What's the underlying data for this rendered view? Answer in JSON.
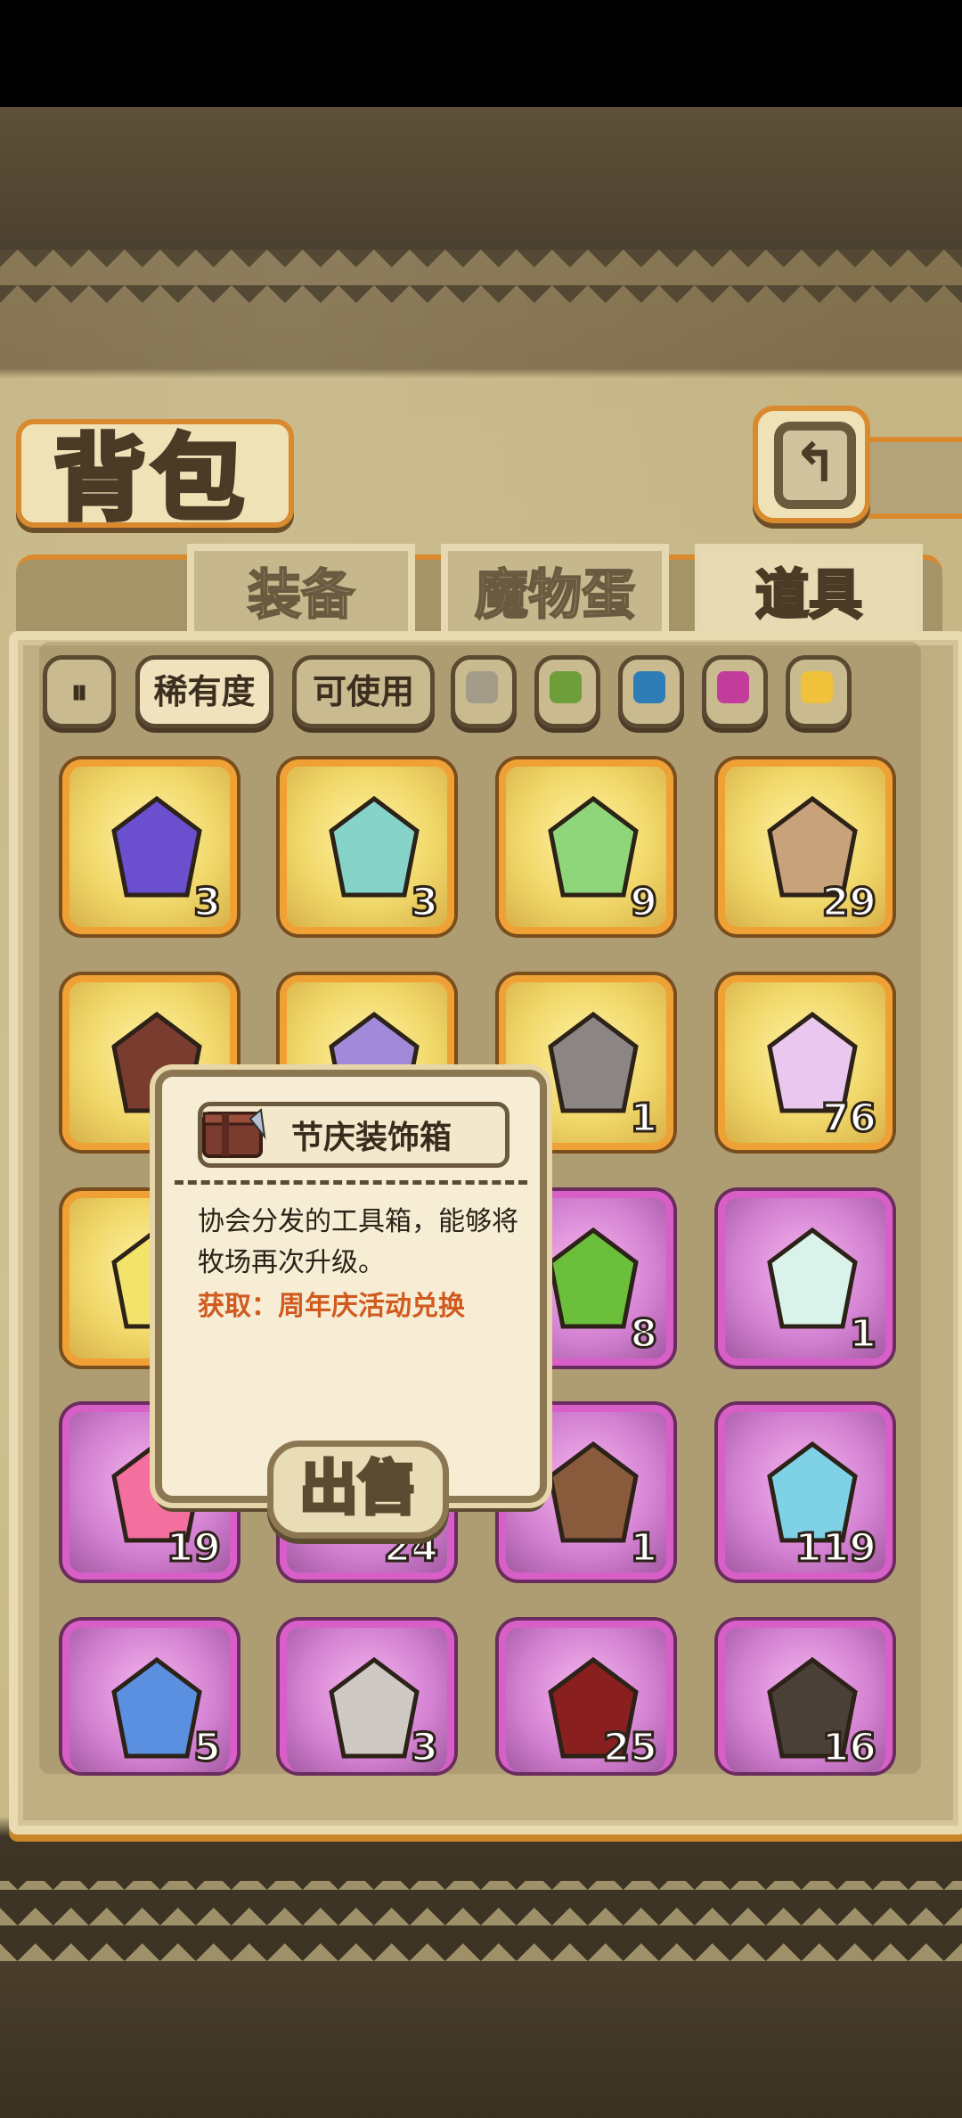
{
  "title": "背包",
  "tabs": [
    {
      "label": "装备",
      "active": false
    },
    {
      "label": "魔物蛋",
      "active": false
    },
    {
      "label": "道具",
      "active": true
    }
  ],
  "filters": {
    "sort_rarity": "稀有度",
    "usable": "可使用",
    "rarity_colors": [
      "#a39c88",
      "#6e9e3a",
      "#2f7db7",
      "#c23d9b",
      "#f0c23c"
    ]
  },
  "items": [
    {
      "name": "purple-crystal",
      "count": "3",
      "tier": "gold"
    },
    {
      "name": "rainbow-mirror-device",
      "count": "3",
      "tier": "gold"
    },
    {
      "name": "ghost-gift-box",
      "count": "9",
      "tier": "gold"
    },
    {
      "name": "ticket",
      "count": "29",
      "tier": "gold"
    },
    {
      "name": "festival-decoration-crate",
      "count": "",
      "tier": "gold"
    },
    {
      "name": "rainbow-cube",
      "count": "",
      "tier": "gold"
    },
    {
      "name": "eraser-block",
      "count": "1",
      "tier": "gold"
    },
    {
      "name": "winged-lantern",
      "count": "76",
      "tier": "gold"
    },
    {
      "name": "potion-bottle",
      "count": "",
      "tier": "gold"
    },
    {
      "name": "hidden-item",
      "count": "",
      "tier": "purple"
    },
    {
      "name": "green-crystal",
      "count": "8",
      "tier": "purple"
    },
    {
      "name": "prism-shard",
      "count": "1",
      "tier": "purple"
    },
    {
      "name": "heart-locket",
      "count": "19",
      "tier": "purple"
    },
    {
      "name": "hidden-item-2",
      "count": "24",
      "tier": "purple"
    },
    {
      "name": "hammer-card",
      "count": "1",
      "tier": "purple"
    },
    {
      "name": "crystal-ball",
      "count": "119",
      "tier": "purple"
    },
    {
      "name": "blue-crystal",
      "count": "5",
      "tier": "purple"
    },
    {
      "name": "scroll-card",
      "count": "3",
      "tier": "purple"
    },
    {
      "name": "cola-bottle",
      "count": "25",
      "tier": "purple"
    },
    {
      "name": "barrel",
      "count": "16",
      "tier": "purple"
    }
  ],
  "popup": {
    "name": "节庆装饰箱",
    "description": "协会分发的工具箱，能够将牧场再次升级。",
    "obtain": "获取：周年庆活动兑换",
    "sell_label": "出售"
  }
}
